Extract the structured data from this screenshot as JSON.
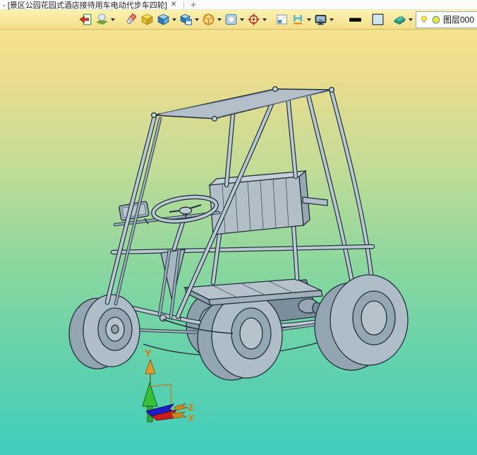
{
  "tab_bar": {
    "active_tab_title": "- [景区公园花园式酒店接待用车电动代步车四轮]",
    "close_label": "✕",
    "new_tab_label": "+"
  },
  "toolbar": {
    "buttons": [
      {
        "name": "exit-icon",
        "dropdown": false
      },
      {
        "name": "render-style-icon",
        "dropdown": true
      },
      {
        "name": "eraser-icon",
        "dropdown": false
      },
      {
        "name": "isometric-view-icon",
        "dropdown": false
      },
      {
        "name": "shaded-cube-icon",
        "dropdown": true
      },
      {
        "name": "cube-window-icon",
        "dropdown": true
      },
      {
        "name": "wireframe-sphere-icon",
        "dropdown": true
      },
      {
        "name": "render-mode-icon",
        "dropdown": true
      },
      {
        "name": "orientation-target-icon",
        "dropdown": true
      },
      {
        "name": "mini-window-icon",
        "dropdown": false
      },
      {
        "name": "dimension-icon",
        "dropdown": true
      },
      {
        "name": "display-icon",
        "dropdown": true
      },
      {
        "name": "line-width-swatch",
        "dropdown": false
      },
      {
        "name": "color-swatch",
        "dropdown": false
      },
      {
        "name": "visual-style-icon",
        "dropdown": true
      }
    ],
    "layer_panel": {
      "label": "图层000"
    }
  },
  "viewport": {
    "background": {
      "top": "#F4E28E",
      "bottom": "#40CDBC"
    },
    "model": {
      "subject": "four-wheel electric sightseeing cart with canopy frame",
      "fill": "#AEBDC7",
      "outline": "#22323C"
    },
    "axis_triad": {
      "x_label": "X",
      "y_label": "Y",
      "z_label": "Z"
    }
  }
}
